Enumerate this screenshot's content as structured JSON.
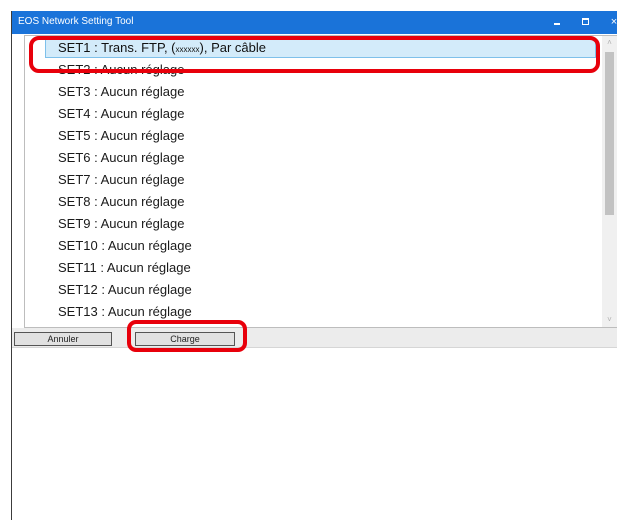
{
  "window": {
    "title": "EOS Network Setting Tool",
    "minimize_glyph": "minimize-icon",
    "maximize_glyph": "maximize-icon",
    "close_label": "×"
  },
  "list": {
    "items": [
      {
        "prefix": "SET1 : Trans. FTP, (",
        "tag": "xxxxxx",
        "suffix": "), Par câble"
      },
      {
        "label": "SET2 : Aucun réglage"
      },
      {
        "label": "SET3 : Aucun réglage"
      },
      {
        "label": "SET4 : Aucun réglage"
      },
      {
        "label": "SET5 : Aucun réglage"
      },
      {
        "label": "SET6 : Aucun réglage"
      },
      {
        "label": "SET7 : Aucun réglage"
      },
      {
        "label": "SET8 : Aucun réglage"
      },
      {
        "label": "SET9 : Aucun réglage"
      },
      {
        "label": "SET10 : Aucun réglage"
      },
      {
        "label": "SET11 : Aucun réglage"
      },
      {
        "label": "SET12 : Aucun réglage"
      },
      {
        "label": "SET13 : Aucun réglage"
      }
    ],
    "selected_index": 0,
    "scroll_up_glyph": "˄",
    "scroll_down_glyph": "˅"
  },
  "buttons": {
    "cancel": "Annuler",
    "load": "Charge"
  },
  "colors": {
    "titlebar": "#1a73d9",
    "selection": "#d3ebfa",
    "highlight": "#e8000b"
  }
}
